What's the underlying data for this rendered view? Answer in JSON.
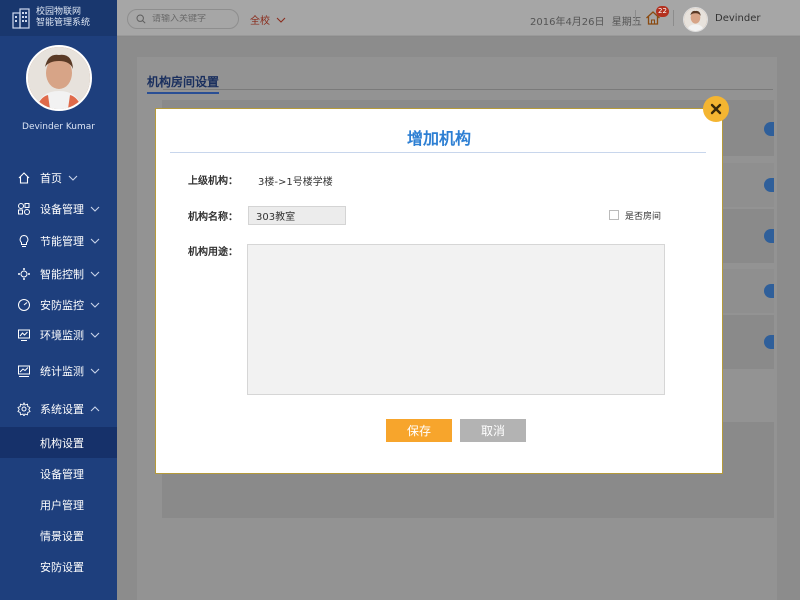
{
  "app": {
    "name_line1": "校园物联网",
    "name_line2": "智能管理系统"
  },
  "profile": {
    "name": "Devinder Kumar"
  },
  "menu": [
    {
      "label": "首页",
      "icon": "home-icon"
    },
    {
      "label": "设备管理",
      "icon": "devices-icon"
    },
    {
      "label": "节能管理",
      "icon": "bulb-icon"
    },
    {
      "label": "智能控制",
      "icon": "control-icon"
    },
    {
      "label": "安防监控",
      "icon": "gauge-icon"
    },
    {
      "label": "环境监测",
      "icon": "monitor-chart-icon"
    },
    {
      "label": "统计监测",
      "icon": "stats-icon"
    },
    {
      "label": "系统设置",
      "icon": "gear-icon"
    }
  ],
  "submenu": [
    {
      "label": "机构设置",
      "active": true
    },
    {
      "label": "设备管理"
    },
    {
      "label": "用户管理"
    },
    {
      "label": "情景设置"
    },
    {
      "label": "安防设置"
    }
  ],
  "topbar": {
    "search_placeholder": "请输入关键字",
    "scope": "全校",
    "date": "2016年4月26日",
    "weekday": "星期五",
    "badge_count": "22",
    "username": "Devinder"
  },
  "page": {
    "title": "机构房间设置"
  },
  "modal": {
    "title": "增加机构",
    "parent_label": "上级机构：",
    "parent_value": "3楼->1号楼学楼",
    "name_label": "机构名称：",
    "name_value": "303教室",
    "is_room_label": "是否房间",
    "purpose_label": "机构用途：",
    "purpose_value": "",
    "save_label": "保存",
    "cancel_label": "取消"
  },
  "colors": {
    "accent_blue": "#2d7fd3",
    "save_orange": "#f7a52c",
    "close_yellow": "#f4b531",
    "sidebar_blue": "#1e3f7d"
  }
}
